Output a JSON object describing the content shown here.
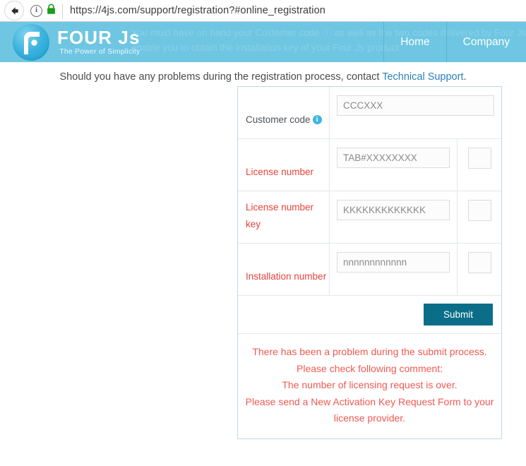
{
  "browser": {
    "back_icon": "back-arrow-icon",
    "site_info_icon": "info-icon",
    "lock_icon": "lock-icon",
    "url": "https://4js.com/support/registration?#online_registration"
  },
  "banner": {
    "background_color": "#6ec6e2",
    "ghost_line1": "You must have on hand your Customer code ⓘ as well as the two codes delivered by Four Js with y",
    "ghost_line2": "enable you to obtain the installation key of your Four Js product.",
    "logo": {
      "title": "FOUR Js",
      "tagline": "The Power of Simplicity",
      "mark_icon": "four-js-f-logo-icon"
    },
    "nav": [
      {
        "label": "Home"
      },
      {
        "label": "Company"
      }
    ]
  },
  "support": {
    "text_before": "Should you have any problems during the registration process, contact ",
    "link_label": "Technical Support",
    "text_after": "."
  },
  "form": {
    "rows": [
      {
        "label": "Customer code",
        "label_color": "#4c5257",
        "has_info_icon": true,
        "info_icon": "info-badge-icon",
        "placeholder": "CCCXXX",
        "value": "",
        "has_extra_box": false
      },
      {
        "label": "License number",
        "label_color": "#e8443a",
        "has_info_icon": false,
        "placeholder": "TAB#XXXXXXXX",
        "value": "",
        "has_extra_box": true,
        "extra_value": ""
      },
      {
        "label": "License number key",
        "label_color": "#e8443a",
        "has_info_icon": false,
        "placeholder": "KKKKKKKKKKKKK",
        "value": "",
        "has_extra_box": true,
        "extra_value": ""
      },
      {
        "label": "Installation number",
        "label_color": "#e8443a",
        "has_info_icon": false,
        "placeholder": "nnnnnnnnnnnn",
        "value": "",
        "has_extra_box": true,
        "extra_value": ""
      }
    ],
    "submit_label": "Submit",
    "submit_color": "#0a6e88"
  },
  "error": {
    "color": "#f05a52",
    "lines": [
      "There has been a problem during the submit process.",
      "Please check following comment:",
      "The number of licensing request is over.",
      "Please send a New Activation Key Request Form to your",
      "license provider."
    ]
  }
}
